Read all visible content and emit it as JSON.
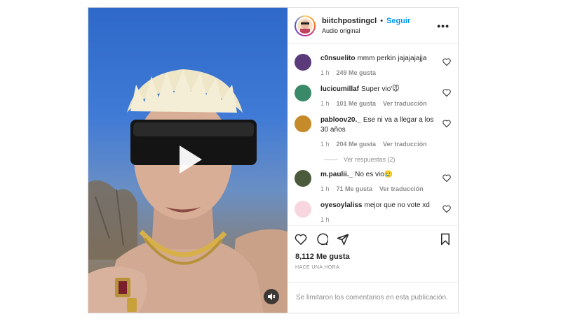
{
  "post": {
    "username": "biitchpostingcl",
    "separator": "•",
    "follow_label": "Seguir",
    "audio": "Audio original",
    "more": "•••",
    "likes": "8,112 Me gusta",
    "time": "HACE UNA HORA",
    "limited_comments": "Se limitaron los comentarios en esta publicación."
  },
  "comments": [
    {
      "user": "c0nsuelito",
      "text": "mmm perkin jajajajajja",
      "time": "1 h",
      "likes": "249 Me gusta",
      "translate": "",
      "avatar_color": "#5b3a7a"
    },
    {
      "user": "lucicumillaf",
      "text": "Super vio'🐭",
      "time": "1 h",
      "likes": "101 Me gusta",
      "translate": "Ver traducción",
      "avatar_color": "#3a8a6a"
    },
    {
      "user": "pabloov20._",
      "text": "Ese ni va a llegar a los 30 años",
      "time": "1 h",
      "likes": "204 Me gusta",
      "translate": "Ver traducción",
      "avatar_color": "#c58a2a"
    },
    {
      "user": "m.paulii._",
      "text": "No es vio🥲",
      "time": "1 h",
      "likes": "71 Me gusta",
      "translate": "Ver traducción",
      "avatar_color": "#4a5a3a"
    },
    {
      "user": "oyesoylaliss",
      "text": "mejor que no vote xd",
      "time": "1 h",
      "likes": "",
      "translate": "",
      "avatar_color": "#f7d6e0"
    }
  ],
  "replies_label": "Ver respuestas (2)",
  "icons": {
    "heart": "heart-icon",
    "comment": "comment-icon",
    "share": "share-icon",
    "save": "bookmark-icon",
    "play": "play-icon",
    "mute": "speaker-muted-icon",
    "more": "more-options-icon"
  },
  "colors": {
    "accent": "#0095f6",
    "muted": "#8e8e8e",
    "border": "#dbdbdb"
  }
}
